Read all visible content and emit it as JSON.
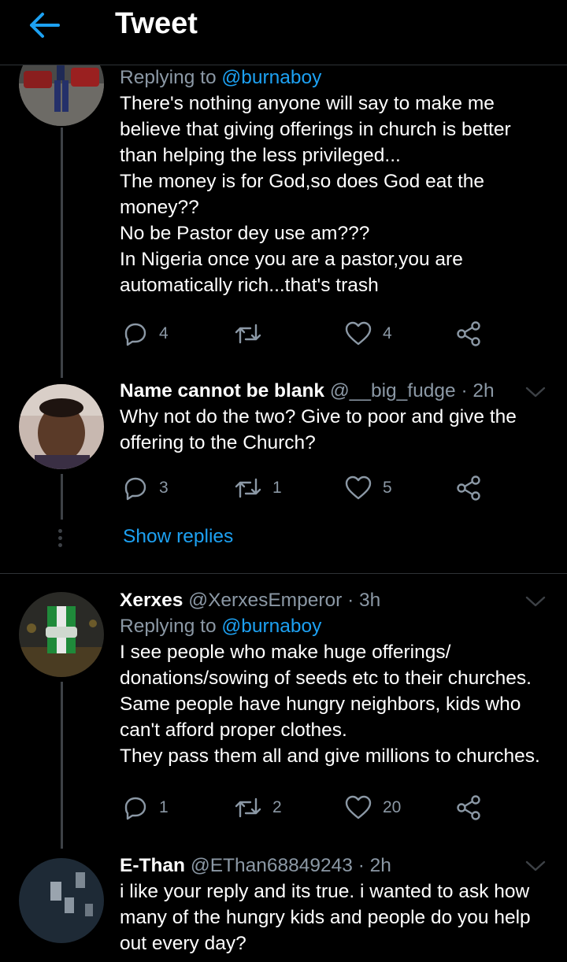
{
  "header": {
    "title": "Tweet"
  },
  "tweets": [
    {
      "replying_prefix": "Replying to ",
      "replying_handle": "@burnaboy",
      "lines": [
        "There's nothing anyone will say to make me",
        "believe that giving offerings in church is better",
        "than helping the less privileged...",
        "The money is for God,so does God eat the",
        "money??",
        "No be Pastor dey use am???",
        "In Nigeria once you are a pastor,you are",
        "automatically rich...that's trash"
      ],
      "replies": "4",
      "retweets": "",
      "likes": "4"
    },
    {
      "name": "Name cannot be blank",
      "handle": "@__big_fudge",
      "time": "· 2h",
      "lines": [
        "Why not do the two? Give to poor and give the",
        "offering to the Church?"
      ],
      "replies": "3",
      "retweets": "1",
      "likes": "5",
      "show_replies": "Show replies"
    },
    {
      "name": "Xerxes",
      "handle": "@XerxesEmperor",
      "time": "· 3h",
      "replying_prefix": "Replying to ",
      "replying_handle": "@burnaboy",
      "lines": [
        "I see people who make huge offerings/",
        "donations/sowing of seeds etc to their churches.",
        "Same people have hungry neighbors, kids who",
        "can't afford proper clothes.",
        "They pass them all and give millions to churches."
      ],
      "replies": "1",
      "retweets": "2",
      "likes": "20"
    },
    {
      "name": "E-Than",
      "handle": "@EThan68849243",
      "time": "· 2h",
      "lines": [
        "i like your reply and its true. i wanted to ask how",
        "many of the hungry kids and people do you help",
        "out every day?"
      ]
    }
  ],
  "icons": {
    "back": "arrow-left-icon",
    "reply": "reply-icon",
    "retweet": "retweet-icon",
    "like": "heart-icon",
    "share": "share-icon",
    "more": "chevron-down-icon"
  },
  "colors": {
    "accent": "#1da1f2",
    "muted": "#8b98a5",
    "background": "#000000"
  }
}
